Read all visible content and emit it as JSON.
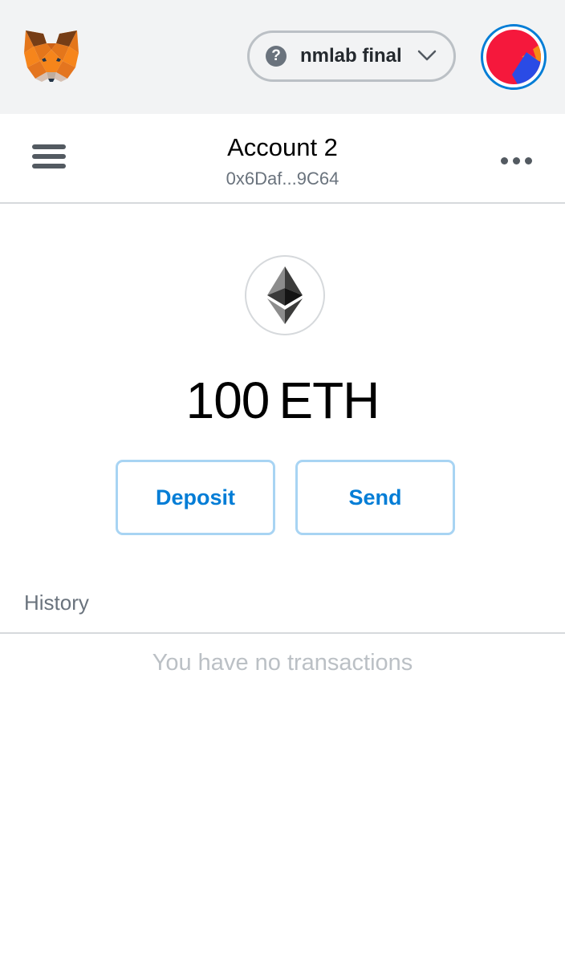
{
  "header": {
    "logo_icon": "metamask-fox-icon",
    "network": {
      "help_icon": "question-circle-icon",
      "help_glyph": "?",
      "name": "nmlab final",
      "chevron_icon": "chevron-down-icon"
    },
    "avatar_icon": "account-identicon"
  },
  "account": {
    "menu_icon": "hamburger-menu-icon",
    "name": "Account 2",
    "address": "0x6Daf...9C64",
    "more_icon": "more-options-icon"
  },
  "balance": {
    "token_icon": "ethereum-icon",
    "amount": "100",
    "unit": "ETH"
  },
  "actions": {
    "deposit_label": "Deposit",
    "send_label": "Send"
  },
  "history": {
    "label": "History",
    "empty_message": "You have no transactions"
  },
  "colors": {
    "header_bg": "#f2f3f4",
    "accent_blue": "#037dd6",
    "button_border": "#a8d4f3",
    "muted_text": "#6a737d",
    "divider": "#d6d9dc"
  }
}
